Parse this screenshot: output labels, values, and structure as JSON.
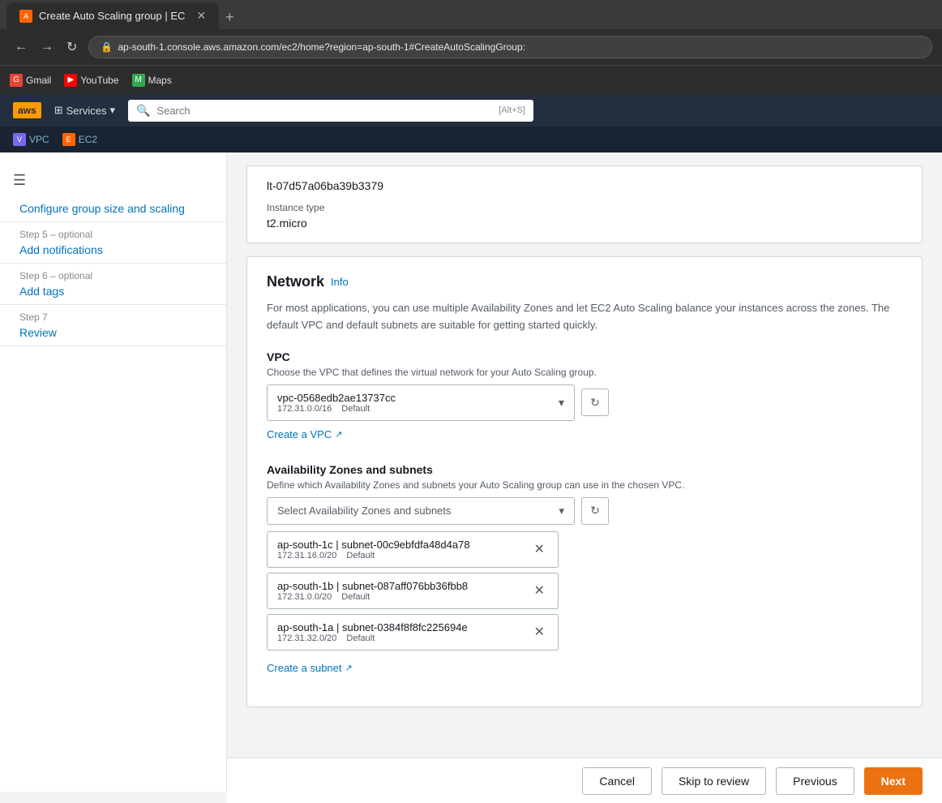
{
  "browser": {
    "tab_title": "Create Auto Scaling group | EC",
    "url": "ap-south-1.console.aws.amazon.com/ec2/home?region=ap-south-1#CreateAutoScalingGroup:",
    "bookmarks": [
      {
        "label": "Gmail",
        "icon": "G",
        "type": "gmail"
      },
      {
        "label": "YouTube",
        "icon": "▶",
        "type": "youtube"
      },
      {
        "label": "Maps",
        "icon": "M",
        "type": "maps"
      }
    ]
  },
  "aws": {
    "logo": "aws",
    "services_label": "Services",
    "search_placeholder": "Search",
    "search_shortcut": "[Alt+S]",
    "breadcrumbs": [
      {
        "label": "VPC",
        "icon": "V",
        "type": "vpc"
      },
      {
        "label": "EC2",
        "icon": "E",
        "type": "ec2"
      }
    ]
  },
  "sidebar": {
    "steps": [
      {
        "id": "step4",
        "label": "Configure group size and scaling",
        "step_text": "Configure group size and scaling",
        "optional": false
      },
      {
        "id": "step5",
        "label": "Add notifications",
        "step_text": "Step 5 – optional",
        "optional": true
      },
      {
        "id": "step6",
        "label": "Add tags",
        "step_text": "Step 6 – optional",
        "optional": true
      },
      {
        "id": "step7",
        "label": "Review",
        "step_text": "Step 7",
        "optional": false
      }
    ]
  },
  "instance": {
    "id": "lt-07d57a06ba39b3379",
    "type_label": "Instance type",
    "type_value": "t2.micro"
  },
  "network": {
    "title": "Network",
    "info_label": "Info",
    "description": "For most applications, you can use multiple Availability Zones and let EC2 Auto Scaling balance your instances across the zones. The default VPC and default subnets are suitable for getting started quickly.",
    "vpc": {
      "label": "VPC",
      "sub_label": "Choose the VPC that defines the virtual network for your Auto Scaling group.",
      "selected_id": "vpc-0568edb2ae13737cc",
      "selected_cidr": "172.31.0.0/16",
      "selected_default": "Default",
      "create_link": "Create a VPC"
    },
    "az": {
      "label": "Availability Zones and subnets",
      "sub_label": "Define which Availability Zones and subnets your Auto Scaling group can use in the chosen VPC.",
      "placeholder": "Select Availability Zones and subnets",
      "subnets": [
        {
          "name": "ap-south-1c | subnet-00c9ebfdfa48d4a78",
          "cidr": "172.31.16.0/20",
          "default": "Default"
        },
        {
          "name": "ap-south-1b | subnet-087aff076bb36fbb8",
          "cidr": "172.31.0.0/20",
          "default": "Default"
        },
        {
          "name": "ap-south-1a | subnet-0384f8f8fc225694e",
          "cidr": "172.31.32.0/20",
          "default": "Default"
        }
      ],
      "create_link": "Create a subnet"
    }
  },
  "footer": {
    "cancel_label": "Cancel",
    "skip_label": "Skip to review",
    "previous_label": "Previous",
    "next_label": "Next"
  }
}
